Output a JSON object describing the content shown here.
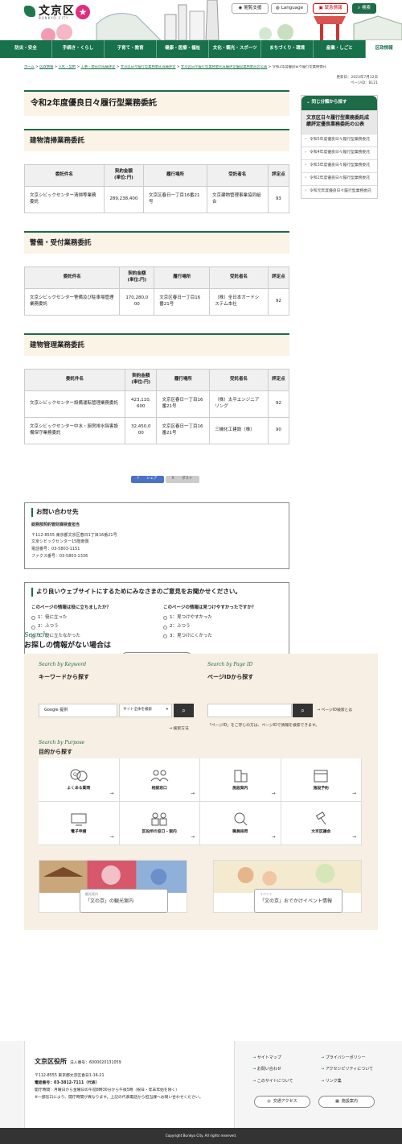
{
  "header": {
    "logo_text": "文京区",
    "logo_sub": "BUNKYO CITY",
    "buttons": {
      "reading": "閲覧支援",
      "language": "Language",
      "emergency": "緊急情報",
      "search": "検索"
    }
  },
  "gnav": [
    "防災・安全",
    "手続き・くらし",
    "子育て・教育",
    "健康・医療・福祉",
    "文化・観光・スポーツ",
    "まちづくり・環境",
    "産業・しごと",
    "区政情報"
  ],
  "breadcrumb": [
    "ホーム",
    "区政情報",
    "入札・契約",
    "工事・委託の成績評定",
    "文京区日々履行型業務委託成績評定",
    "文京区日々履行型業務委託成績評定優良業務委託の公表",
    "令和2年度優良日々履行型業務委託"
  ],
  "updated": "更新日：2023年7月12日",
  "page_id": "ページID：8121",
  "page_title": "令和2年度優良日々履行型業務委託",
  "sections": [
    {
      "title": "建物清掃業務委託",
      "headers": [
        "委託件名",
        "契約金額\n(単位:円)",
        "履行場所",
        "受託者名",
        "評定点"
      ],
      "rows": [
        [
          "文京シビックセンター清掃等業務委託",
          "289,238,400",
          "文京区春日一丁目16番21号",
          "文京建物管理事業協同組合",
          "93"
        ]
      ]
    },
    {
      "title": "警備・受付業務委託",
      "headers": [
        "委託件名",
        "契約金額\n(単位:円)",
        "履行場所",
        "受託者名",
        "評定点"
      ],
      "rows": [
        [
          "文京シビックセンター警備及び駐車場管理業務委託",
          "170,280,000",
          "文京区春日一丁目16番21号",
          "（株）全日本ガードシステム本社",
          "92"
        ]
      ]
    },
    {
      "title": "建物管理業務委託",
      "headers": [
        "委託件名",
        "契約金額\n(単位:円)",
        "履行場所",
        "受託者名",
        "評定点"
      ],
      "rows": [
        [
          "文京シビックセンター設備運転管理業務委託",
          "423,110,600",
          "文京区春日一丁目16番21号",
          "（株）太平エンジニアリング",
          "92"
        ],
        [
          "文京シビックセンター中水・厨房排水除害設備保守業務委託",
          "32,450,000",
          "文京区春日一丁目16番21号",
          "三機化工建設（株）",
          "90"
        ]
      ]
    }
  ],
  "share": {
    "facebook": "シェア",
    "x": "ポスト"
  },
  "contact": {
    "title": "お問い合わせ先",
    "dept": "総務部契約管財課検査担当",
    "lines": [
      "〒112-8555 東京都文京区春日1丁目16番21号",
      "文京シビックセンター15階南側",
      "電話番号：03-5803-1151",
      "ファクス番号：03-5803-1336"
    ]
  },
  "survey": {
    "title": "より良いウェブサイトにするためにみなさまのご意見をお聞かせください。",
    "q1": "このページの情報は役に立ちましたか？",
    "q1_opts": [
      "1：役に立った",
      "2：ふつう",
      "3：役に立たなかった"
    ],
    "q2": "このページの情報は見つけやすかったですか？",
    "q2_opts": [
      "1：見つけやすかった",
      "2：ふつう",
      "3：見つけにくかった"
    ],
    "send": "送信"
  },
  "sidebar": {
    "heading": "同じ分類から探す",
    "current": "文京区日々履行型業務委託成績評定優良業務委託の公表",
    "items": [
      "令和5年度優良日々履行型業務委託",
      "令和4年度優良日々履行型業務委託",
      "令和3年度優良日々履行型業務委託",
      "令和2年度優良日々履行型業務委託",
      "令和元年度優良日々履行型業務委託"
    ]
  },
  "search": {
    "en": "Search",
    "title": "お探しの情報がない場合は",
    "kw_en": "Search by Keyword",
    "kw_title": "キーワードから探す",
    "kw_input": "Google 提供",
    "kw_select": "サイト全体を検索",
    "kw_method": "検索方法",
    "pid_en": "Search by Page ID",
    "pid_title": "ページIDから探す",
    "pid_link": "ページID検索とは",
    "pid_note": "「ページID」をご存じの方は、ページIDで情報を検索できます。",
    "pur_en": "Search by Purpose",
    "pur_title": "目的から探す",
    "purposes": [
      "よくある質問",
      "相談窓口",
      "施設案内",
      "施設予約",
      "電子申請",
      "区役所の窓口・案内",
      "職員採用",
      "文京区議会"
    ]
  },
  "banners": [
    {
      "kicker": "観光案内",
      "text": "「文の京」の観光案内"
    },
    {
      "kicker": "イベント",
      "text": "「文の京」おでかけイベント情報"
    }
  ],
  "footer": {
    "name": "文京区役所",
    "corp_no": "法人番号：6000020131059",
    "addr": "〒112-8555 東京都文京区春日1-16-21",
    "tel": "電話番号：03-3812-7111（代表）",
    "hours": "開庁時間：月曜日から金曜日の午前8時30分から午後5時（祝日・年末年始を除く）",
    "note": "※一部窓口により、開庁時間が異なります。上記の代表電話から担当課へお問い合わせください。",
    "links": [
      "サイトマップ",
      "プライバシーポリシー",
      "お問い合わせ",
      "アクセシビリティについて",
      "このサイトについて",
      "リンク集"
    ],
    "access": "交通アクセス",
    "facility": "施設案内",
    "copyright": "Copyright Bunkyo City. All rights reserved."
  }
}
